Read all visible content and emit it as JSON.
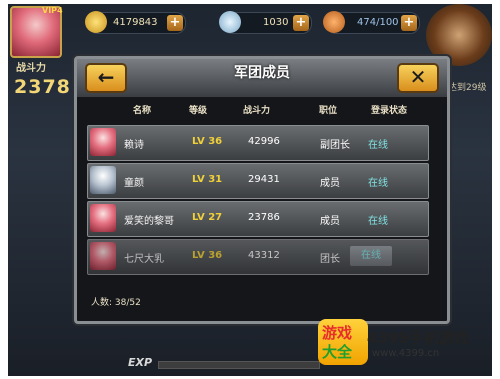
{
  "topbar": {
    "vip_label": "VIP4",
    "gold": "4179843",
    "diamond": "1030",
    "stamina": "474/100",
    "skull_text": "达到29级",
    "battle_label": "战斗力",
    "battle_value": "2378"
  },
  "dialog": {
    "title": "军团成员",
    "back_icon": "←",
    "close_icon": "✕",
    "columns": [
      "名称",
      "等级",
      "战斗力",
      "职位",
      "登录状态"
    ],
    "members": [
      {
        "name": "赖诗",
        "level": "LV 36",
        "power": "42996",
        "role": "副团长",
        "status": "在线"
      },
      {
        "name": "童颜",
        "level": "LV 31",
        "power": "29431",
        "role": "成员",
        "status": "在线"
      },
      {
        "name": "爱笑的黎哥",
        "level": "LV 27",
        "power": "23786",
        "role": "成员",
        "status": "在线"
      },
      {
        "name": "七尺大乳",
        "level": "LV 36",
        "power": "43312",
        "role": "团长",
        "status": "在线"
      }
    ],
    "count_label": "人数:",
    "count_value": "38/52"
  },
  "bottom": {
    "exp_label": "EXP",
    "logo_top": "游戏",
    "logo_bottom": "大全",
    "brand": "4399手机游戏",
    "site": "www.4399.cn"
  }
}
